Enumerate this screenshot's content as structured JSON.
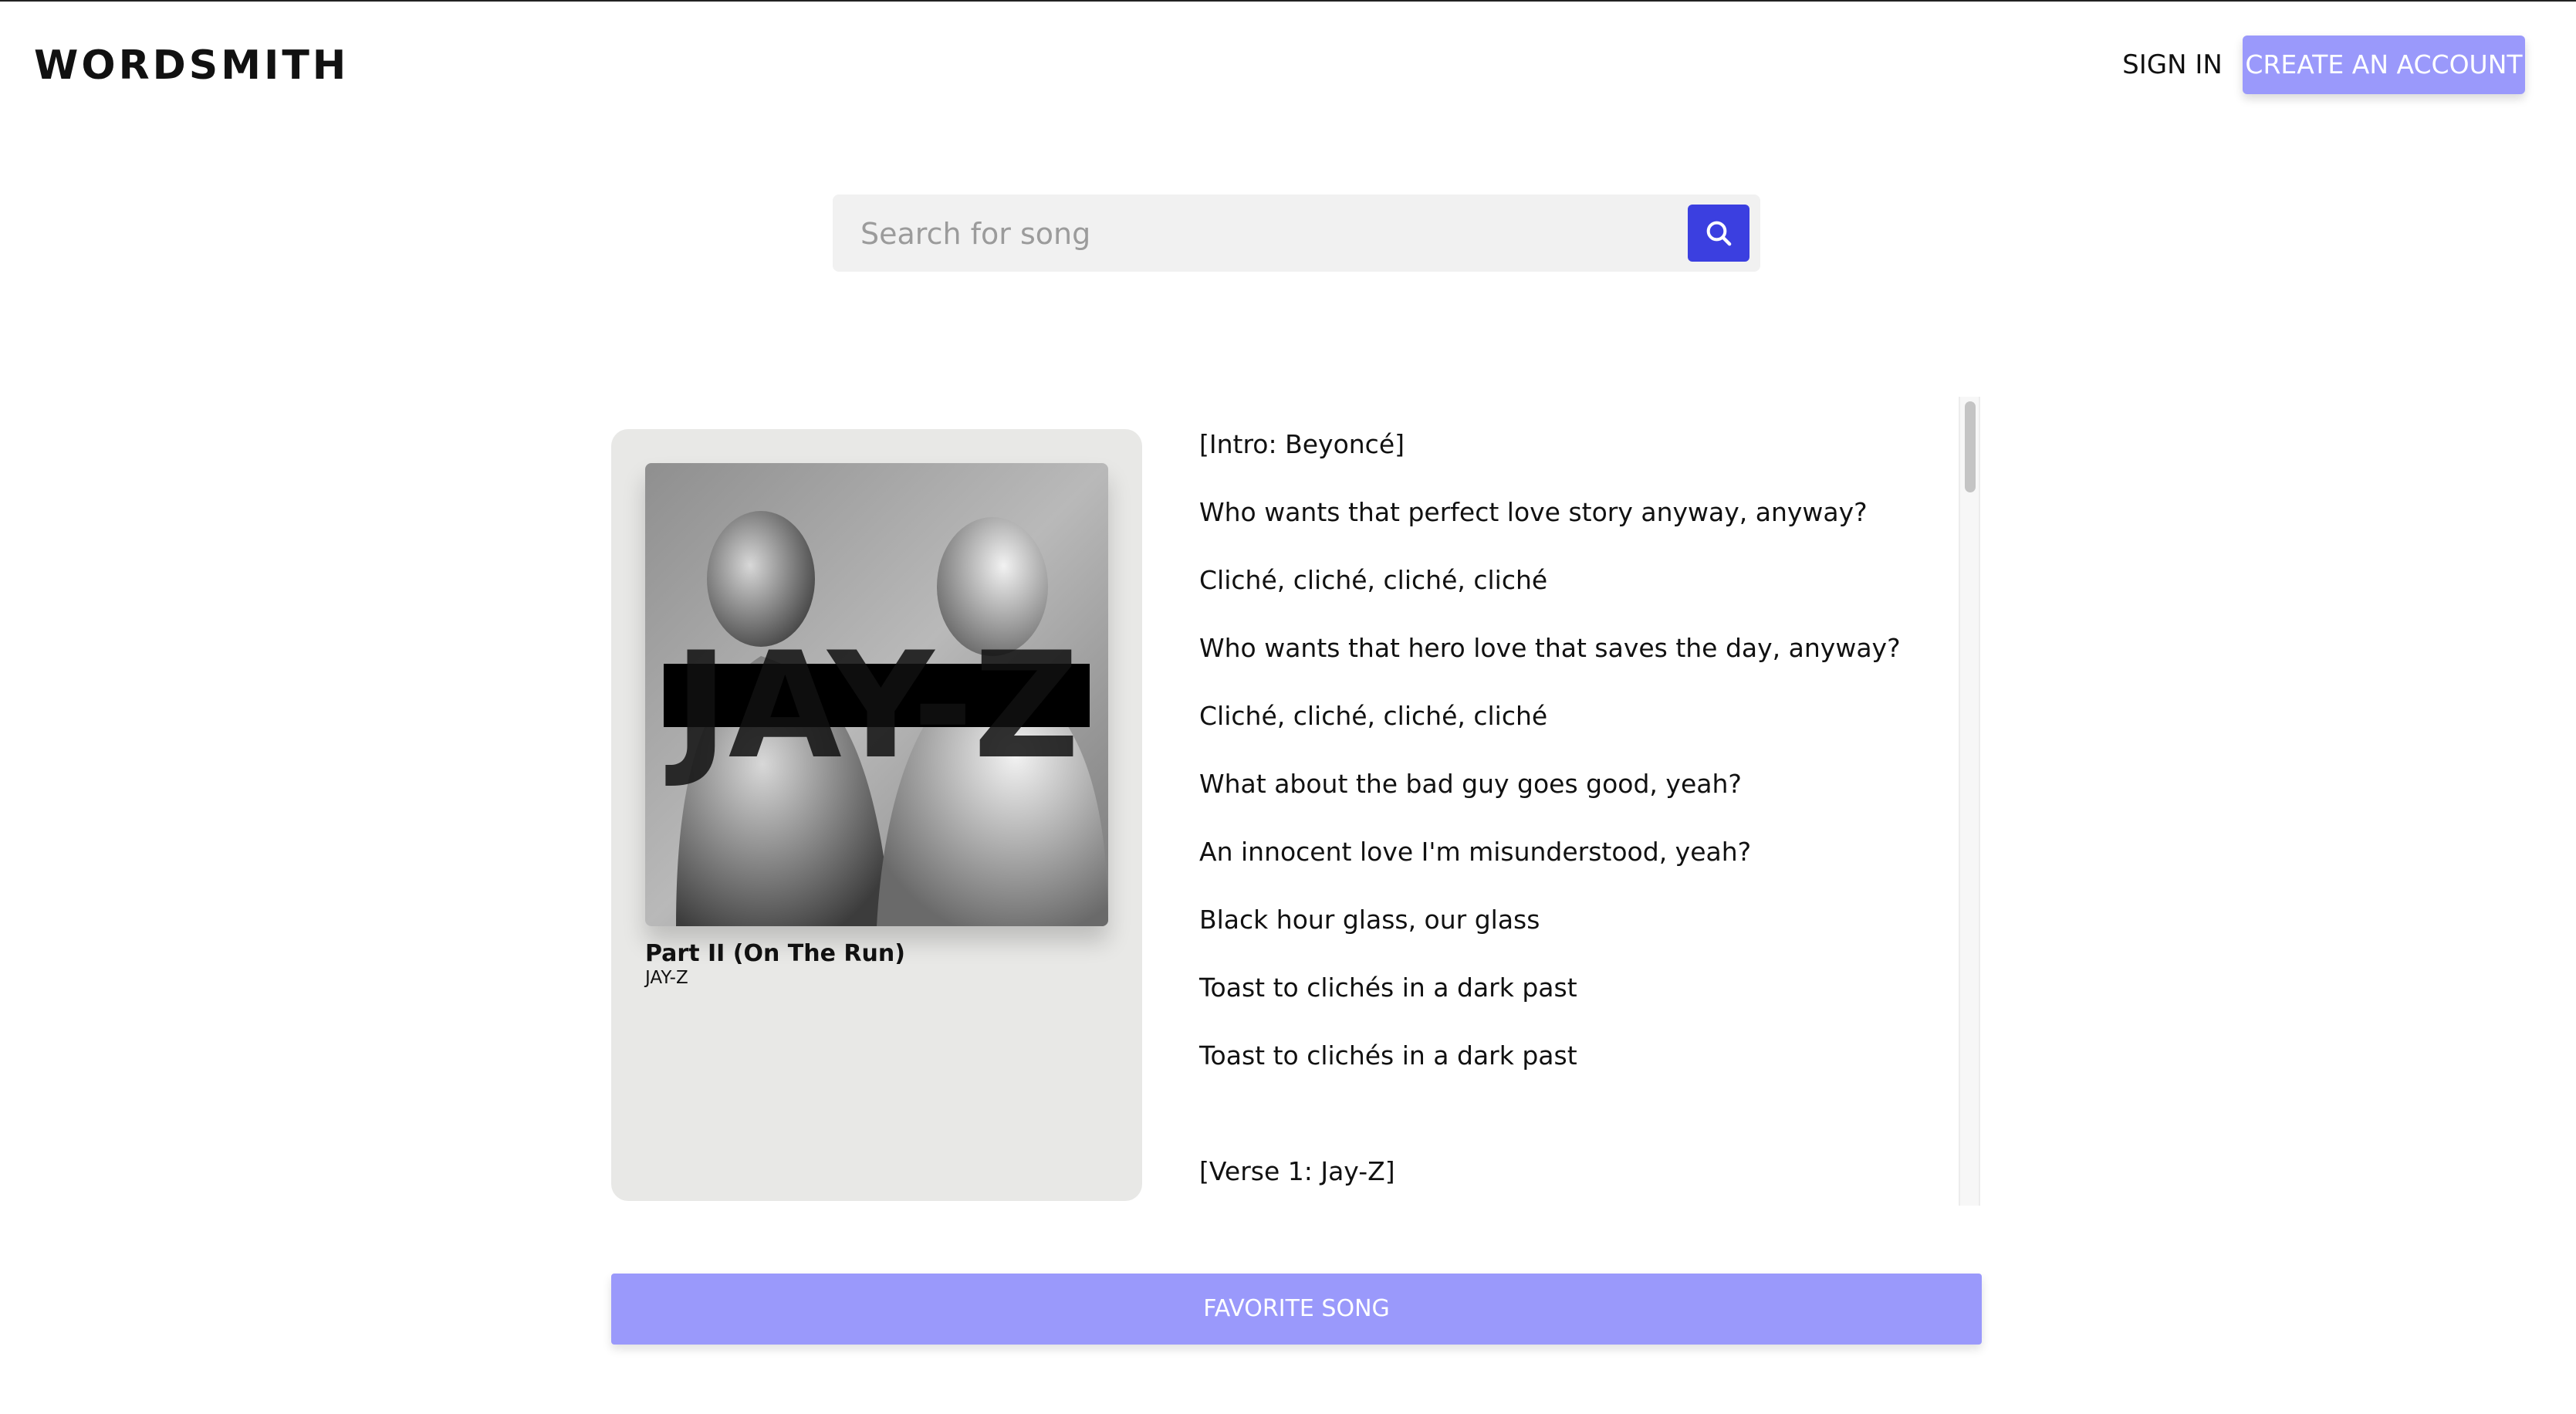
{
  "header": {
    "brand": "WORDSMITH",
    "sign_in": "SIGN IN",
    "create_account": "CREATE AN ACCOUNT"
  },
  "search": {
    "placeholder": "Search for song",
    "value": "",
    "button_icon": "search-icon"
  },
  "song": {
    "title": "Part II (On The Run)",
    "artist": "JAY-Z",
    "cover_text": "JAY-Z"
  },
  "lyrics": [
    "[Intro: Beyoncé]",
    "Who wants that perfect love story anyway, anyway?",
    "Cliché, cliché, cliché, cliché",
    "Who wants that hero love that saves the day, anyway?",
    "Cliché, cliché, cliché, cliché",
    "What about the bad guy goes good, yeah?",
    "An innocent love I'm misunderstood, yeah?",
    "Black hour glass, our glass",
    "Toast to clichés in a dark past",
    "Toast to clichés in a dark past",
    "[Verse 1: Jay-Z]"
  ],
  "actions": {
    "favorite": "FAVORITE SONG"
  },
  "colors": {
    "accent": "#9a99fb",
    "search_button": "#3b3fe0",
    "card_bg": "#e8e8e6"
  }
}
